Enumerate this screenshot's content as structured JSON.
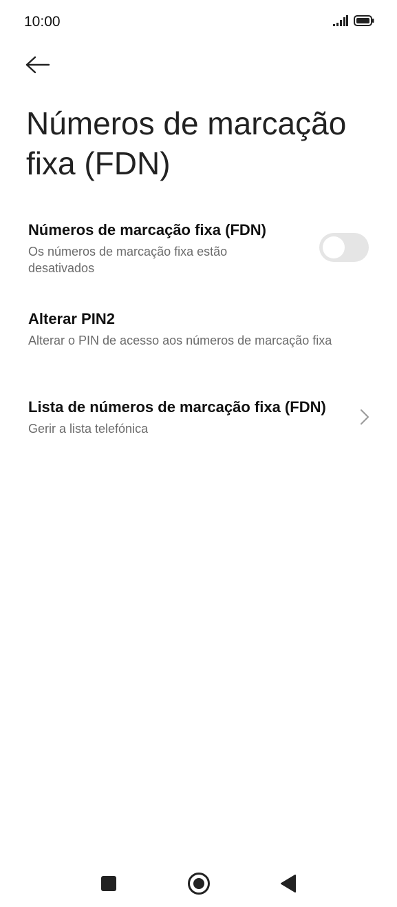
{
  "status_bar": {
    "time": "10:00",
    "signal_icon": "signal-bars-icon",
    "battery_icon": "battery-icon"
  },
  "header": {
    "back_icon": "arrow-left-icon",
    "title": "Números de marcação fixa (FDN)"
  },
  "items": [
    {
      "title": "Números de marcação fixa (FDN)",
      "subtitle": "Os números de marcação fixa estão desativados",
      "control": "toggle",
      "toggle_on": false
    },
    {
      "title": "Alterar PIN2",
      "subtitle": "Alterar o PIN de acesso aos números de marcação fixa",
      "control": "none"
    },
    {
      "title": "Lista de números de marcação fixa (FDN)",
      "subtitle": "Gerir a lista telefónica",
      "control": "chevron-right-icon"
    }
  ],
  "nav_bar": {
    "recents_icon": "square-icon",
    "home_icon": "circle-home-icon",
    "back_icon": "triangle-back-icon"
  },
  "colors": {
    "background": "#ffffff",
    "title_text": "#111111",
    "subtitle_text": "#6b6b6b",
    "toggle_off_track": "#e5e5e5",
    "nav_icons": "#222222"
  }
}
